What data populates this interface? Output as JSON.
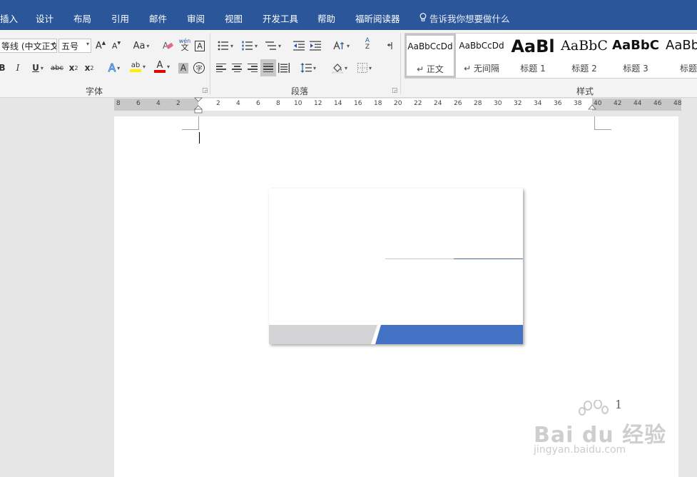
{
  "tabs": [
    "插入",
    "设计",
    "布局",
    "引用",
    "邮件",
    "审阅",
    "视图",
    "开发工具",
    "帮助",
    "福昕阅读器"
  ],
  "tell_me": "告诉我你想要做什么",
  "font": {
    "font_name": "等线 (中文正文",
    "font_size": "五号",
    "grow_label": "A",
    "shrink_label": "A",
    "case_label": "Aa",
    "phonetic_top": "wén",
    "phonetic_bottom": "文",
    "border_char": "A",
    "bold": "B",
    "italic": "I",
    "underline": "U",
    "strike": "abc",
    "subscript_base": "x",
    "subscript": "2",
    "superscript_base": "x",
    "superscript": "2",
    "effects": "A",
    "highlight": "ab",
    "font_color": "A",
    "shading": "A",
    "enclose": "字",
    "group_label": "字体"
  },
  "paragraph": {
    "sort_a": "A",
    "sort_z": "Z",
    "group_label": "段落"
  },
  "styles": {
    "group_label": "样式",
    "items": [
      {
        "preview": "AaBbCcDd",
        "name": "↵ 正文"
      },
      {
        "preview": "AaBbCcDd",
        "name": "↵ 无间隔"
      },
      {
        "preview": "AaBl",
        "name": "标题 1"
      },
      {
        "preview": "AaBbC",
        "name": "标题 2"
      },
      {
        "preview": "AaBbC",
        "name": "标题 3"
      },
      {
        "preview": "AaBb",
        "name": "标题"
      }
    ]
  },
  "ruler": {
    "left_numbers": [
      "8",
      "6",
      "4",
      "2"
    ],
    "right_numbers": [
      "2",
      "4",
      "6",
      "8",
      "10",
      "12",
      "14",
      "16",
      "18",
      "20",
      "22",
      "24",
      "26",
      "28",
      "30",
      "32",
      "34",
      "36",
      "38",
      "40",
      "42",
      "44",
      "46",
      "48"
    ]
  },
  "document": {
    "page_number": "1",
    "card_gray_color": "#d4d4d6",
    "card_blue_color": "#4472c4"
  },
  "watermark": {
    "brand": "Bai du 经验",
    "url": "jingyan.baidu.com"
  },
  "colors": {
    "accent": "#2b579a",
    "highlight_yellow": "#ffee00",
    "font_red": "#e00000"
  }
}
